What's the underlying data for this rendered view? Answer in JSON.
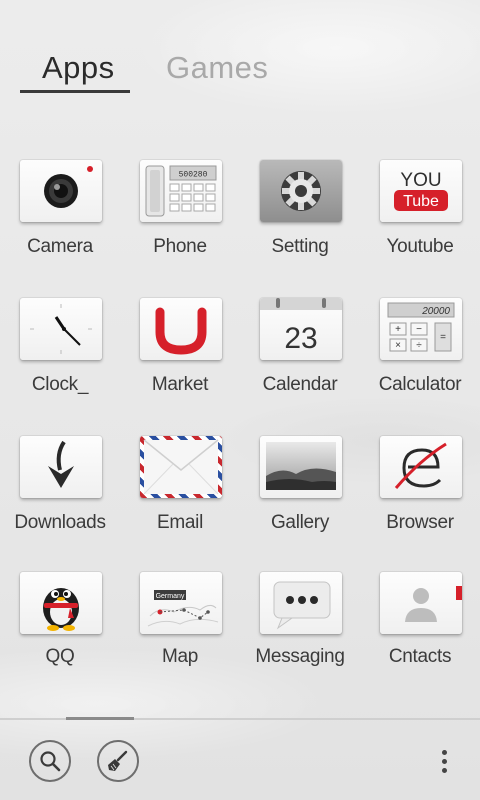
{
  "tabs": {
    "apps": "Apps",
    "games": "Games"
  },
  "apps": [
    {
      "label": "Camera",
      "icon": "camera-icon"
    },
    {
      "label": "Phone",
      "icon": "phone-icon",
      "display": "500280"
    },
    {
      "label": "Setting",
      "icon": "gear-icon"
    },
    {
      "label": "Youtube",
      "icon": "youtube-icon",
      "top_text": "YOU",
      "badge_text": "Tube"
    },
    {
      "label": "Clock_",
      "icon": "clock-icon"
    },
    {
      "label": "Market",
      "icon": "market-icon"
    },
    {
      "label": "Calendar",
      "icon": "calendar-icon",
      "day": "23"
    },
    {
      "label": "Calculator",
      "icon": "calculator-icon",
      "display": "20000"
    },
    {
      "label": "Downloads",
      "icon": "download-arrow-icon"
    },
    {
      "label": "Email",
      "icon": "envelope-icon"
    },
    {
      "label": "Gallery",
      "icon": "landscape-photo-icon"
    },
    {
      "label": "Browser",
      "icon": "browser-e-icon"
    },
    {
      "label": "QQ",
      "icon": "penguin-icon"
    },
    {
      "label": "Map",
      "icon": "map-icon",
      "tag": "Germany"
    },
    {
      "label": "Messaging",
      "icon": "speech-bubble-icon"
    },
    {
      "label": "Cntacts",
      "icon": "contact-person-icon"
    }
  ],
  "dock": {
    "search_icon": "search-icon",
    "clean_icon": "broom-icon",
    "menu_icon": "overflow-menu-icon"
  },
  "colors": {
    "accent_red": "#d6202a",
    "tab_active": "#2b2b2b",
    "tab_inactive": "#a9a9a9"
  }
}
